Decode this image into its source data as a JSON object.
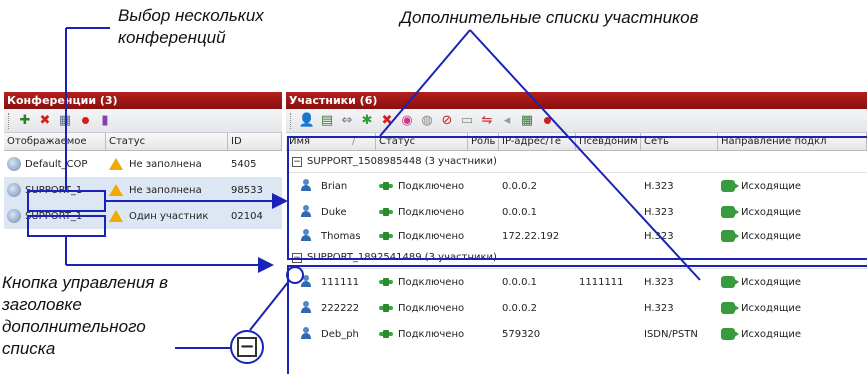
{
  "callouts": {
    "multi_select": "Выбор нескольких\nконференций",
    "extra_lists": "Дополнительные списки участников",
    "control_button": "Кнопка управления в\nзаголовке\nдополнительного\nсписка"
  },
  "conferences_panel": {
    "title": "Конференции (3)",
    "columns": [
      "Отображаемое",
      "Статус",
      "ID"
    ],
    "rows": [
      {
        "name": "Default_COP",
        "status": "Не заполнена",
        "id": "5405"
      },
      {
        "name": "SUPPORT_1",
        "status": "Не заполнена",
        "id": "98533"
      },
      {
        "name": "SUPPORT_1",
        "status": "Один участник",
        "id": "02104"
      }
    ]
  },
  "participants_panel": {
    "title": "Участники (6)",
    "columns": [
      "Имя",
      "Статус",
      "Роль",
      "IP-адрес/Те",
      "Псевдоним",
      "Сеть",
      "Направление подкл"
    ],
    "groups": [
      {
        "header": "SUPPORT_1508985448 (3 участники)",
        "collapse_symbol": "−",
        "rows": [
          {
            "name": "Brian",
            "status": "Подключено",
            "ip": "0.0.0.2",
            "alias": "",
            "network": "H.323",
            "direction": "Исходящие"
          },
          {
            "name": "Duke",
            "status": "Подключено",
            "ip": "0.0.0.1",
            "alias": "",
            "network": "H.323",
            "direction": "Исходящие"
          },
          {
            "name": "Thomas",
            "status": "Подключено",
            "ip": "172.22.192",
            "alias": "",
            "network": "H.323",
            "direction": "Исходящие"
          }
        ]
      },
      {
        "header": "SUPPORT_1892541489 (3 участники)",
        "collapse_symbol": "−",
        "rows": [
          {
            "name": "111111",
            "status": "Подключено",
            "ip": "0.0.0.1",
            "alias": "1111111",
            "network": "H.323",
            "direction": "Исходящие"
          },
          {
            "name": "222222",
            "status": "Подключено",
            "ip": "0.0.0.2",
            "alias": "",
            "network": "H.323",
            "direction": "Исходящие"
          },
          {
            "name": "Deb_ph",
            "status": "Подключено",
            "ip": "579320",
            "alias": "",
            "network": "ISDN/PSTN",
            "direction": "Исходящие"
          }
        ]
      }
    ]
  },
  "zoom_button_symbol": "−",
  "colors": {
    "title_bar": "#a31816",
    "annotation": "#1a23b7",
    "selection": "#dde7f3",
    "status_green": "#36a93a",
    "warning": "#f2a900"
  }
}
